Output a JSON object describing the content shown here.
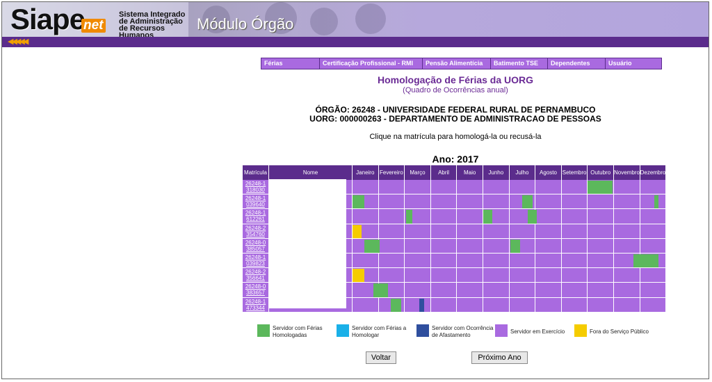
{
  "header": {
    "logo": "Siape",
    "logo_suffix": "net",
    "tagline": "Sistema Integrado de Administração de Recursos Humanos",
    "module": "Módulo Órgão",
    "back_arrows": "◀◀◀◀◀"
  },
  "menu": [
    "Férias",
    "Certificação Profissional - RMI",
    "Pensão Alimentícia",
    "Batimento TSE",
    "Dependentes",
    "Usuário"
  ],
  "page": {
    "title": "Homologação de Férias da UORG",
    "subtitle": "(Quadro de Ocorrências anual)",
    "orgao": "ÓRGÃO: 26248 - UNIVERSIDADE FEDERAL RURAL DE PERNAMBUCO",
    "uorg": "UORG: 000000263 - DEPARTAMENTO DE ADMINISTRACAO DE PESSOAS",
    "instruction": "Clique na matrícula para homologá-la ou recusá-la",
    "year_label": "Ano: 2017"
  },
  "table": {
    "col_matricula": "Matrícula",
    "col_nome": "Nome",
    "months": [
      "Janeiro",
      "Fevereiro",
      "Março",
      "Abril",
      "Maio",
      "Junho",
      "Julho",
      "Agosto",
      "Setembro",
      "Outubro",
      "Novembro",
      "Dezembro"
    ],
    "rows": [
      {
        "matricula": "26248-1318030",
        "marks": [
          {
            "start": 9.0,
            "end": 9.95,
            "status": "homologadas"
          }
        ]
      },
      {
        "matricula": "26248-1039640",
        "marks": [
          {
            "start": 0.0,
            "end": 0.45,
            "status": "homologadas"
          },
          {
            "start": 6.5,
            "end": 6.9,
            "status": "homologadas"
          },
          {
            "start": 11.55,
            "end": 11.7,
            "status": "homologadas"
          }
        ]
      },
      {
        "matricula": "26248-1612261",
        "marks": [
          {
            "start": 2.05,
            "end": 2.3,
            "status": "homologadas"
          },
          {
            "start": 5.0,
            "end": 5.35,
            "status": "homologadas"
          },
          {
            "start": 6.7,
            "end": 7.05,
            "status": "homologadas"
          }
        ]
      },
      {
        "matricula": "26248-2354760",
        "marks": [
          {
            "start": 0.0,
            "end": 0.35,
            "status": "fora"
          }
        ]
      },
      {
        "matricula": "26248-0385057",
        "marks": [
          {
            "start": 0.45,
            "end": 1.05,
            "status": "homologadas"
          },
          {
            "start": 6.05,
            "end": 6.4,
            "status": "homologadas"
          }
        ]
      },
      {
        "matricula": "26248-1039823",
        "marks": [
          {
            "start": 10.75,
            "end": 11.7,
            "status": "homologadas"
          }
        ]
      },
      {
        "matricula": "26248-2356641",
        "marks": [
          {
            "start": 0.0,
            "end": 0.45,
            "status": "fora"
          }
        ]
      },
      {
        "matricula": "26248-0383657",
        "marks": [
          {
            "start": 0.8,
            "end": 1.35,
            "status": "homologadas"
          }
        ]
      },
      {
        "matricula": "26248-1473344",
        "marks": [
          {
            "start": 1.45,
            "end": 1.85,
            "status": "homologadas"
          },
          {
            "start": 2.55,
            "end": 2.75,
            "status": "afastamento"
          }
        ]
      }
    ]
  },
  "legend": [
    {
      "label": "Servidor com Férias Homologadas",
      "color": "#5cb85c"
    },
    {
      "label": "Servidor com Férias a Homologar",
      "color": "#1ab0e8"
    },
    {
      "label": "Servidor com Ocorrência de Afastamento",
      "color": "#2f4f9e"
    },
    {
      "label": "Servidor em Exercício",
      "color": "#a96ae0"
    },
    {
      "label": "Fora do Serviço Público",
      "color": "#f5cc00"
    }
  ],
  "status_colors": {
    "homologadas": "#5cb85c",
    "a_homologar": "#1ab0e8",
    "afastamento": "#2f4f9e",
    "fora": "#f5cc00"
  },
  "buttons": {
    "back": "Voltar",
    "next": "Próximo Ano"
  }
}
